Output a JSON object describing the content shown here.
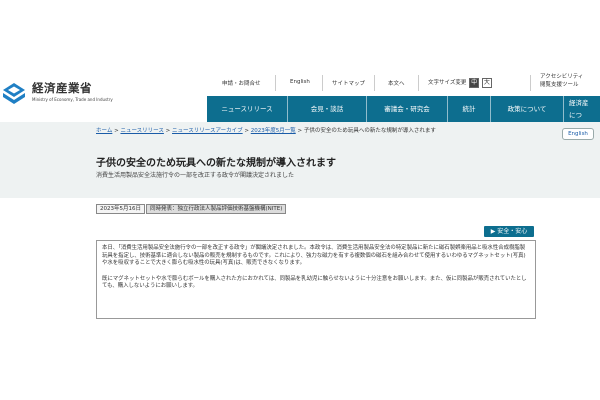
{
  "brand": {
    "name": "経済産業省",
    "sub": "Ministry of Economy, Trade and Industry"
  },
  "utility": {
    "contact": "申請・お問合せ",
    "english": "English",
    "sitemap": "サイトマップ",
    "text_only": "本文へ",
    "text_size_label": "文字サイズ変更",
    "size_medium": "中",
    "size_large": "大",
    "accessibility": "アクセシビリティ",
    "reading_support": "閲覧支援ツール"
  },
  "nav": {
    "items": [
      "ニュースリリース",
      "会見・談話",
      "審議会・研究会",
      "統計",
      "政策について"
    ],
    "last_line1": "経済産",
    "last_line2": "につ"
  },
  "breadcrumb": {
    "items": [
      "ホーム",
      "ニュースリリース",
      "ニュースリリースアーカイブ",
      "2023年度5月一覧"
    ],
    "separator": ">",
    "current": "子供の安全のため玩具への新たな規制が導入されます"
  },
  "english_button": "English",
  "page": {
    "title": "子供の安全のため玩具への新たな規制が導入されます",
    "subtitle": "消費生活用製品安全法施行令の一部を改正する政令が閣議決定されました"
  },
  "meta": {
    "date": "2023年5月16日",
    "joint": "同時発表：独立行政法人製品評価技術基盤機構(NITE)"
  },
  "tag": {
    "icon": "arrow-right-icon",
    "label": "安全・安心"
  },
  "body": {
    "p1": "本日、「消費生活用製品安全法施行令の一部を改正する政令」が閣議決定されました。本政令は、消費生活用製品安全法の特定製品に新たに磁石製娯楽用品と吸水性合成樹脂製玩具を指定し、技術基準に適合しない製品の販売を規制するものです。これにより、強力な磁力を有する複数個の磁石を組み合わせて使用するいわゆるマグネットセット(写真)や水を吸収することで大きく膨らむ吸水性の玩具(写真)は、販売できなくなります。",
    "p2": "既にマグネットセットや水で膨らむボールを購入された方におかれては、同製品を乳幼児に触らせないように十分注意をお願いします。また、仮に同製品が販売されていたとしても、購入しないようにお願いします。"
  },
  "colors": {
    "nav_bg": "#0d6e8f",
    "content_band": "#eef2f2",
    "link": "#1a5ca8",
    "logo_blue": "#1f7fc4"
  }
}
